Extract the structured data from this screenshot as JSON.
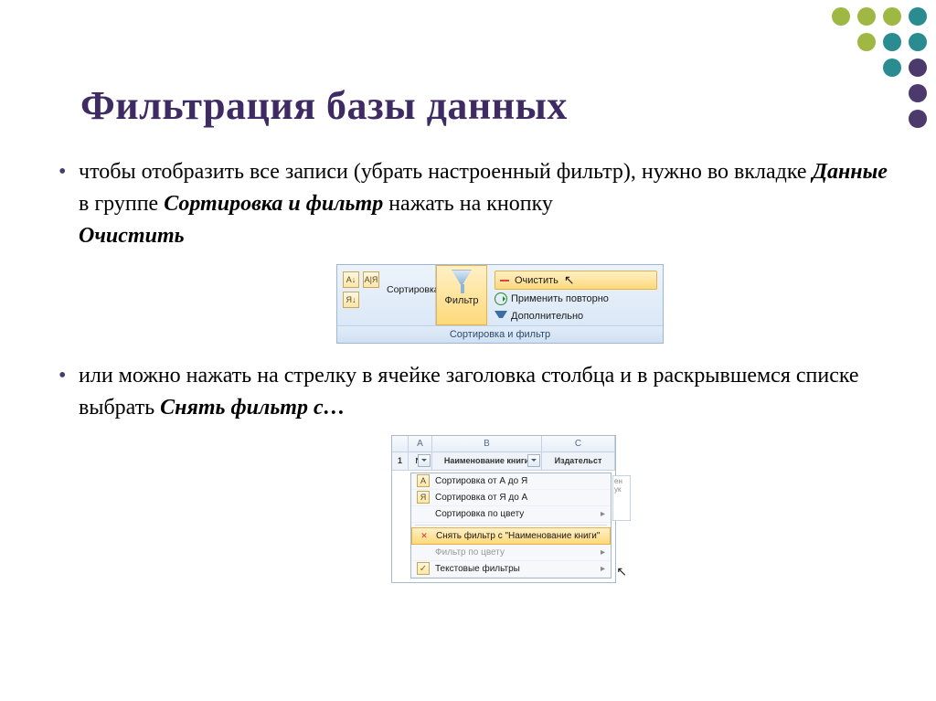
{
  "title": "Фильтрация базы данных",
  "bullets": {
    "b1_a": "чтобы отобразить все записи (убрать настроенный фильтр), нужно во вкладке ",
    "b1_k1": "Данные",
    "b1_b": " в группе ",
    "b1_k2": "Сортировка и фильтр",
    "b1_c": " нажать на кнопку ",
    "b1_k3": "Очистить",
    "b2_a": "или можно нажать на стрелку в ячейке заголовка столбца и в раскрывшемся списке выбрать ",
    "b2_k1": "Снять фильтр с…"
  },
  "ribbon1": {
    "sort_label": "Сортировка",
    "sort_az_icon": "А↓",
    "sort_za_icon": "Я↓",
    "sort_dlg_icon": "А|Я",
    "filter_label": "Фильтр",
    "action_clear": "Очистить",
    "action_reapply": "Применить повторно",
    "action_advanced": "Дополнительно",
    "group_caption": "Сортировка и фильтр"
  },
  "ribbon2": {
    "cols": {
      "corner": "",
      "a": "A",
      "b": "B",
      "c": "C"
    },
    "row1_label": "1",
    "head_no": "№",
    "head_b": "Наименование книги",
    "head_c": "Издательст",
    "menu": {
      "sort_az": "Сортировка от А до Я",
      "sort_za": "Сортировка от Я до А",
      "sort_color": "Сортировка по цвету",
      "clear_filter": "Снять фильтр с \"Наименование книги\"",
      "filter_color": "Фильтр по цвету",
      "text_filters": "Текстовые фильтры"
    },
    "side_fragment": "ен\nук"
  }
}
